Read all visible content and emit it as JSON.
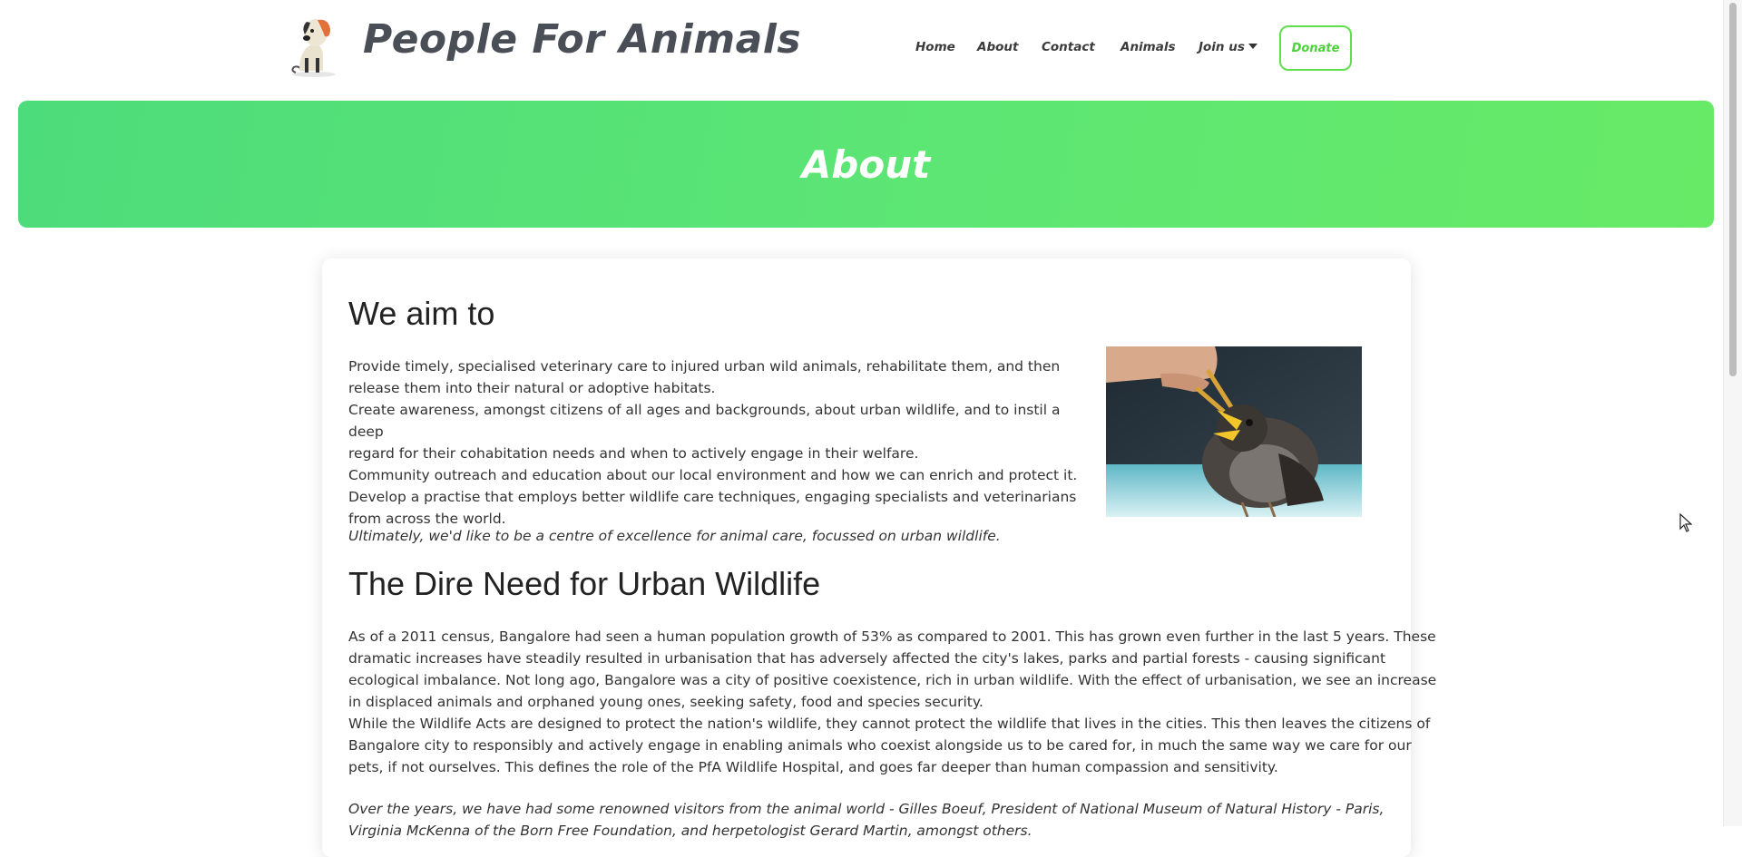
{
  "header": {
    "brand": "People For Animals",
    "logo_icon": "dog-logo-icon",
    "nav": [
      {
        "label": "Home"
      },
      {
        "label": "About"
      },
      {
        "label": "Contact"
      },
      {
        "label": "Animals"
      },
      {
        "label": "Join us"
      }
    ],
    "donate_label": "Donate"
  },
  "banner": {
    "title": "About",
    "colors": [
      "#4ddc7b",
      "#67ea66"
    ]
  },
  "section1": {
    "heading": "We aim to",
    "lines": [
      "Provide timely, specialised veterinary care to injured urban wild animals, rehabilitate them, and then",
      "release them into their natural or adoptive habitats.",
      "Create awareness, amongst citizens of all ages and backgrounds, about urban wildlife, and to instil a deep",
      "regard for their cohabitation needs and when to actively engage in their welfare.",
      "Community outreach and education about our local environment and how we can enrich and protect it.",
      "Develop a practise that employs better wildlife care techniques, engaging specialists and veterinarians",
      "from across the world."
    ],
    "closing": "Ultimately, we'd like to be a centre of excellence for animal care, focussed on urban wildlife.",
    "image_subject": "hand-feeding-baby-bird-photo"
  },
  "section2": {
    "heading": "The Dire Need for Urban Wildlife",
    "lines": [
      "As of a 2011 census, Bangalore had seen a human population growth of 53% as compared to 2001. This has grown even further in the last 5 years. These",
      "dramatic increases have steadily resulted in urbanisation that has adversely affected the city's lakes, parks and partial forests - causing significant",
      "ecological imbalance. Not long ago, Bangalore was a city of positive coexistence, rich in urban wildlife. With the effect of urbanisation, we see an increase",
      "in displaced animals and orphaned young ones, seeking safety, food and species security.",
      "While the Wildlife Acts are designed to protect the nation's wildlife, they cannot protect the wildlife that lives in the cities. This then leaves the citizens of",
      "Bangalore city to responsibly and actively engage in enabling animals who coexist alongside us to be cared for, in much the same way we care for our",
      "pets, if not ourselves. This defines the role of the PfA Wildlife Hospital, and goes far deeper than human compassion and sensitivity."
    ],
    "closing_lines": [
      "Over the years, we have had some renowned visitors from the animal world - Gilles Boeuf, President of National Museum of Natural History - Paris,",
      "Virginia McKenna of the Born Free Foundation, and herpetologist Gerard Martin, amongst others."
    ]
  }
}
